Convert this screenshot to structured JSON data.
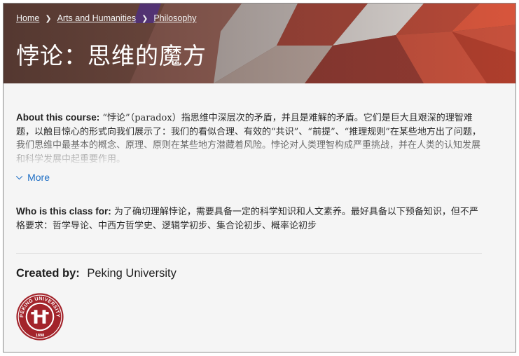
{
  "breadcrumb": {
    "home": "Home",
    "category": "Arts and Humanities",
    "subcategory": "Philosophy"
  },
  "course": {
    "title": "悖论：思维的魔方"
  },
  "about": {
    "label": "About this course:",
    "text": "“悖论”（paradox）指思维中深层次的矛盾，并且是难解的矛盾。它们是巨大且艰深的理智难题，以触目惊心的形式向我们展示了：我们的看似合理、有效的“共识”、“前提”、“推理规则”在某些地方出了问题，我们思维中最基本的概念、原理、原则在某些地方潜藏着风险。悖论对人类理智构成严重挑战，并在人类的认知发展和科学发展中起重要作用。",
    "more_label": "More"
  },
  "audience": {
    "label": "Who is this class for:",
    "text": "为了确切理解悖论，需要具备一定的科学知识和人文素养。最好具备以下预备知识，但不严格要求：哲学导论、中西方哲学史、逻辑学初步、集合论初步、概率论初步"
  },
  "creator": {
    "label": "Created by:",
    "name": "Peking University",
    "logo_text": "PEKING UNIVERSITY",
    "logo_year": "1898"
  },
  "colors": {
    "link": "#1f6fc5",
    "logo_red": "#a3242b"
  }
}
